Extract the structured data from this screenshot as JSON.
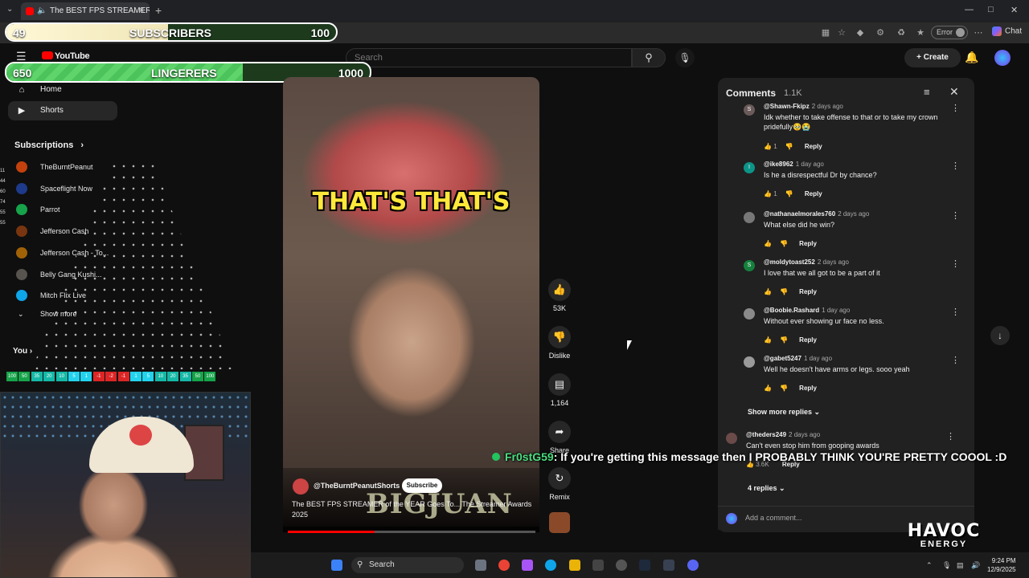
{
  "browser": {
    "tab_title": "The BEST FPS STREAMER of th",
    "error_label": "Error",
    "chat_label": "Chat"
  },
  "goals": {
    "subs": {
      "current": "49",
      "label": "SUBSCRIBERS",
      "target": "100",
      "progress": 0.49
    },
    "lingerers": {
      "current": "650",
      "label": "LINGERERS",
      "target": "1000",
      "progress": 0.65
    }
  },
  "youtube": {
    "logo": "YouTube",
    "search_placeholder": "Search",
    "create_label": "Create"
  },
  "sidebar": {
    "items": [
      {
        "label": "Home"
      },
      {
        "label": "Shorts"
      }
    ],
    "subscriptions_header": "Subscriptions",
    "subscriptions": [
      {
        "name": "TheBurntPeanut",
        "color": "#c2410c"
      },
      {
        "name": "Spaceflight Now",
        "color": "#1e3a8a"
      },
      {
        "name": "Parrot",
        "color": "#16a34a"
      },
      {
        "name": "Jefferson Cash",
        "color": "#78350f"
      },
      {
        "name": "Jefferson Cash - To...",
        "color": "#a16207"
      },
      {
        "name": "Belly Gang Kushi...",
        "color": "#57534e"
      },
      {
        "name": "Mitch Flix Live",
        "color": "#0ea5e9"
      }
    ],
    "show_more": "Show more",
    "you_label": "You",
    "level_numbers": [
      "11",
      "44",
      "60",
      "74",
      "55",
      "55"
    ]
  },
  "multiplier_row": [
    "100",
    "50",
    "35",
    "20",
    "10",
    "5",
    "1",
    "-1",
    "-2",
    "-1",
    "1",
    "5",
    "10",
    "20",
    "35",
    "50",
    "100"
  ],
  "video": {
    "caption": "THAT'S THAT'S",
    "channel": "@TheBurntPeanutShorts",
    "subscribe_label": "Subscribe",
    "title": "The BEST FPS STREAMER of the YEAR Goes To... The Streamer Awards 2025",
    "overlay_text": "BIGJUAN",
    "progress": 0.35
  },
  "actions": {
    "likes": "53K",
    "dislike_label": "Dislike",
    "comments": "1,164",
    "share_label": "Share",
    "remix_label": "Remix"
  },
  "comments_panel": {
    "title": "Comments",
    "count": "1.1K",
    "items": [
      {
        "user": "@Shawn-Fkipz",
        "ago": "2 days ago",
        "text": "Idk whether to take offense to that or to take my crown pridefully🥹😭",
        "likes": "1",
        "avatar_letter": "S",
        "color": "#6b5a5a"
      },
      {
        "user": "@ike8962",
        "ago": "1 day ago",
        "text": "Is he a disrespectful Dr by chance?",
        "likes": "1",
        "avatar_letter": "I",
        "color": "#0d9488"
      },
      {
        "user": "@nathanaelmorales760",
        "ago": "2 days ago",
        "text": "What else did he win?",
        "likes": "",
        "avatar_letter": "",
        "color": "#777777"
      },
      {
        "user": "@moldytoast252",
        "ago": "2 days ago",
        "text": "I love that we all got to be a part of it",
        "likes": "",
        "avatar_letter": "S",
        "color": "#15803d"
      },
      {
        "user": "@Boobie.Rashard",
        "ago": "1 day ago",
        "text": "Without ever showing ur face no less.",
        "likes": "",
        "avatar_letter": "",
        "color": "#8a8a8a"
      },
      {
        "user": "@gabet5247",
        "ago": "1 day ago",
        "text": "Well he doesn't have arms or legs. sooo yeah",
        "likes": "",
        "avatar_letter": "",
        "color": "#9a9a9a"
      }
    ],
    "reply_label": "Reply",
    "show_more_replies": "Show more replies",
    "top_comment": {
      "user": "@theders249",
      "ago": "2 days ago",
      "text": "Can't even stop him from gooping awards",
      "likes": "3.6K"
    },
    "replies_label": "4 replies",
    "add_placeholder": "Add a comment..."
  },
  "stream_chat": {
    "name": "Fr0stG59",
    "message": ": If you're getting this message then I PROBABLY THINK YOU'RE PRETTY COOOL :D"
  },
  "sponsor": {
    "line1": "HAVOC",
    "line2": "ENERGY"
  },
  "taskbar": {
    "search_label": "Search",
    "time": "9:24 PM",
    "date": "12/9/2025"
  }
}
